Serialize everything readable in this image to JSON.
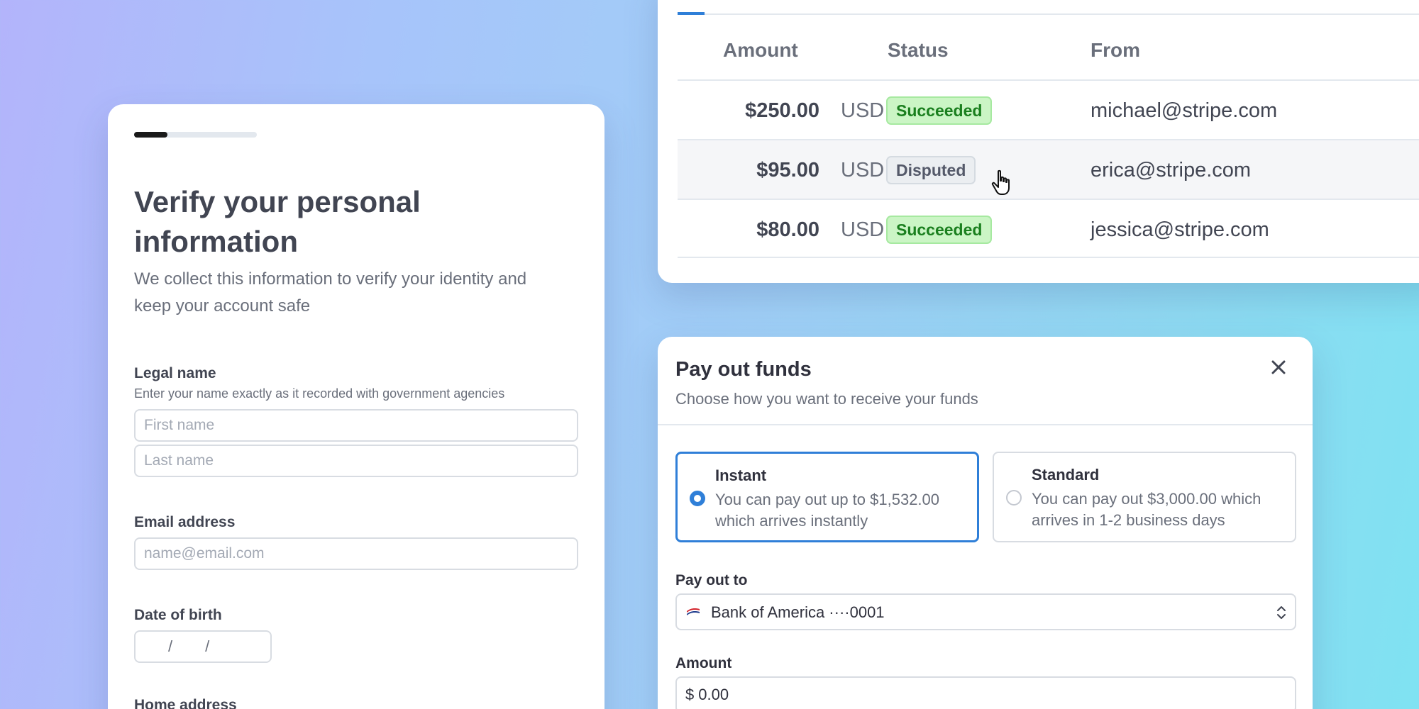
{
  "verify": {
    "progress_fraction": 0.27,
    "title": "Verify your personal information",
    "subtitle": "We collect this information to verify your identity and keep your account safe",
    "legal_name": {
      "label": "Legal name",
      "hint": "Enter your name exactly as it recorded with government agencies",
      "first_placeholder": "First name",
      "last_placeholder": "Last name"
    },
    "email": {
      "label": "Email address",
      "placeholder": "name@email.com"
    },
    "dob": {
      "label": "Date of birth",
      "sep1": "/",
      "sep2": "/"
    },
    "home_address": {
      "label": "Home address"
    }
  },
  "payments": {
    "columns": {
      "amount": "Amount",
      "status": "Status",
      "from": "From"
    },
    "rows": [
      {
        "amount": "$250.00",
        "currency": "USD",
        "status": "Succeeded",
        "from": "michael@stripe.com"
      },
      {
        "amount": "$95.00",
        "currency": "USD",
        "status": "Disputed",
        "from": "erica@stripe.com"
      },
      {
        "amount": "$80.00",
        "currency": "USD",
        "status": "Succeeded",
        "from": "jessica@stripe.com"
      }
    ]
  },
  "payout": {
    "title": "Pay out funds",
    "subtitle": "Choose how you want to receive your funds",
    "options": [
      {
        "title": "Instant",
        "desc": "You can pay out up to $1,532.00 which arrives instantly",
        "selected": true
      },
      {
        "title": "Standard",
        "desc": "You can pay out $3,000.00 which arrives in 1-2 business days",
        "selected": false
      }
    ],
    "pay_out_to": {
      "label": "Pay out to",
      "value": "Bank of America ····0001",
      "icon": "bank-of-america-flag-icon"
    },
    "amount": {
      "label": "Amount",
      "prefix": "$",
      "value": "0.00"
    }
  },
  "colors": {
    "accent": "#2f7fd8",
    "success_bg": "#cbf5c5",
    "success_text": "#1a7f1e",
    "disputed_bg": "#ebeef1"
  }
}
